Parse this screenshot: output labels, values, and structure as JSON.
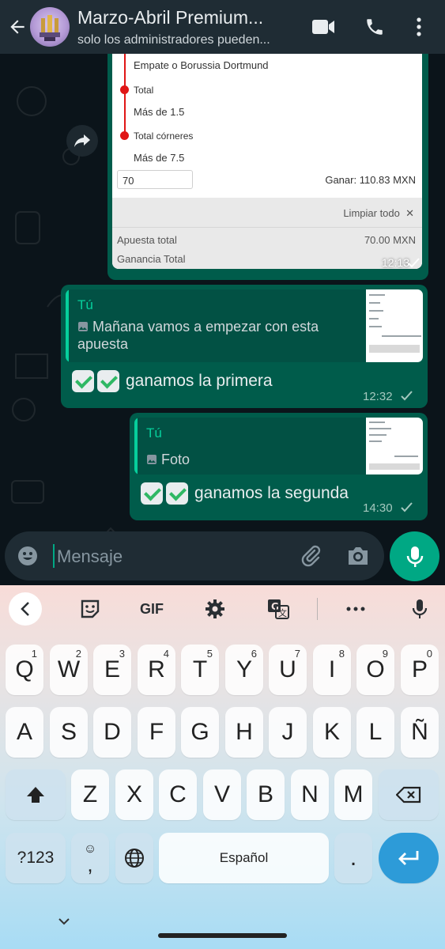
{
  "header": {
    "title": "Marzo-Abril Premium...",
    "subtitle": "solo los administradores pueden..."
  },
  "slip": {
    "selection_1": "Empate o Borussia Dortmund",
    "market_2": "Total",
    "selection_2": "Más de 1.5",
    "market_3": "Total córneres",
    "selection_3": "Más de 7.5",
    "stake": "70",
    "win": "Ganar: 110.83 MXN",
    "clear_all": "Limpiar todo",
    "total_bet_label": "Apuesta total",
    "total_bet_value": "70.00 MXN",
    "total_gain_label": "Ganancia Total",
    "time": "12:13"
  },
  "messages": [
    {
      "quote_author": "Tú",
      "quote_text": "Mañana vamos a empezar con esta apuesta",
      "text": "ganamos la primera",
      "time": "12:32"
    },
    {
      "quote_author": "Tú",
      "quote_text": "Foto",
      "text": "ganamos la segunda",
      "time": "14:30"
    }
  ],
  "composer": {
    "placeholder": "Mensaje"
  },
  "keyboard": {
    "toolbar": [
      "back",
      "sticker",
      "GIF",
      "settings",
      "translate",
      "more",
      "mic"
    ],
    "gif_label": "GIF",
    "row1": [
      {
        "k": "Q",
        "n": "1"
      },
      {
        "k": "W",
        "n": "2"
      },
      {
        "k": "E",
        "n": "3"
      },
      {
        "k": "R",
        "n": "4"
      },
      {
        "k": "T",
        "n": "5"
      },
      {
        "k": "Y",
        "n": "6"
      },
      {
        "k": "U",
        "n": "7"
      },
      {
        "k": "I",
        "n": "8"
      },
      {
        "k": "O",
        "n": "9"
      },
      {
        "k": "P",
        "n": "0"
      }
    ],
    "row2": [
      "A",
      "S",
      "D",
      "F",
      "G",
      "H",
      "J",
      "K",
      "L",
      "Ñ"
    ],
    "row3": [
      "Z",
      "X",
      "C",
      "V",
      "B",
      "N",
      "M"
    ],
    "sym_label": "?123",
    "comma": ",",
    "space_label": "Español",
    "period": "."
  },
  "colors": {
    "header_bg": "#1f2c34",
    "chat_bg": "#0b141a",
    "outgoing_bubble": "#005c4b",
    "accent_green": "#00a884",
    "quote_green": "#06cf9c",
    "slip_red": "#e01616",
    "enter_blue": "#2d9bd8"
  }
}
